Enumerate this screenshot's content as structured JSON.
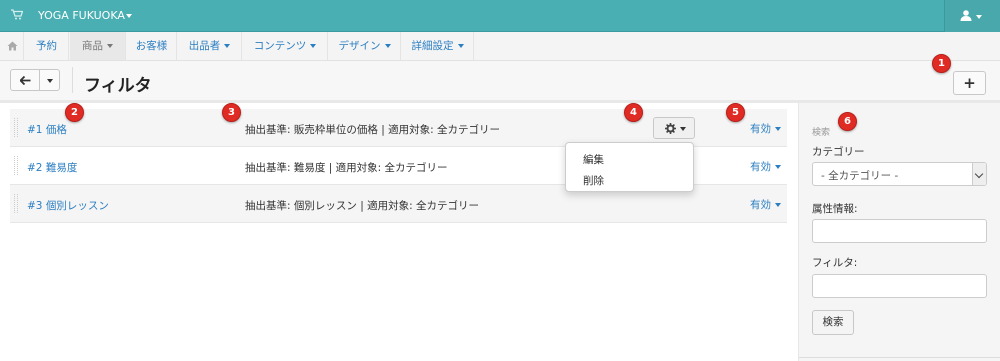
{
  "header": {
    "store_name": "YOGA FUKUOKA",
    "icons": {
      "cart": "cart-icon",
      "user": "user-icon"
    }
  },
  "nav": {
    "items": [
      {
        "label": "予約",
        "dropdown": false
      },
      {
        "label": "商品",
        "dropdown": true,
        "active": true
      },
      {
        "label": "お客様",
        "dropdown": false
      },
      {
        "label": "出品者",
        "dropdown": true
      },
      {
        "label": "コンテンツ",
        "dropdown": true
      },
      {
        "label": "デザイン",
        "dropdown": true
      },
      {
        "label": "詳細設定",
        "dropdown": true
      }
    ]
  },
  "toolbar": {
    "title": "フィルタ",
    "add_label": "+"
  },
  "filters": [
    {
      "name": "#1 価格",
      "description": "抽出基準: 販売枠単位の価格 | 適用対象: 全カテゴリー",
      "status": "有効"
    },
    {
      "name": "#2 難易度",
      "description": "抽出基準: 難易度 | 適用対象: 全カテゴリー",
      "status": "有効"
    },
    {
      "name": "#3 個別レッスン",
      "description": "抽出基準: 個別レッスン | 適用対象: 全カテゴリー",
      "status": "有効"
    }
  ],
  "row_menu": {
    "items": [
      "編集",
      "削除"
    ]
  },
  "sidebar": {
    "heading": "検索",
    "category_label": "カテゴリー",
    "category_value": "- 全カテゴリー -",
    "attribute_label": "属性情報:",
    "attribute_value": "",
    "filter_label": "フィルタ:",
    "filter_value": "",
    "search_button": "検索"
  },
  "markers": [
    "1",
    "2",
    "3",
    "4",
    "5",
    "6"
  ],
  "colors": {
    "topbar": "#4aafb2",
    "link": "#2a7ec2",
    "marker": "#e02b24"
  }
}
